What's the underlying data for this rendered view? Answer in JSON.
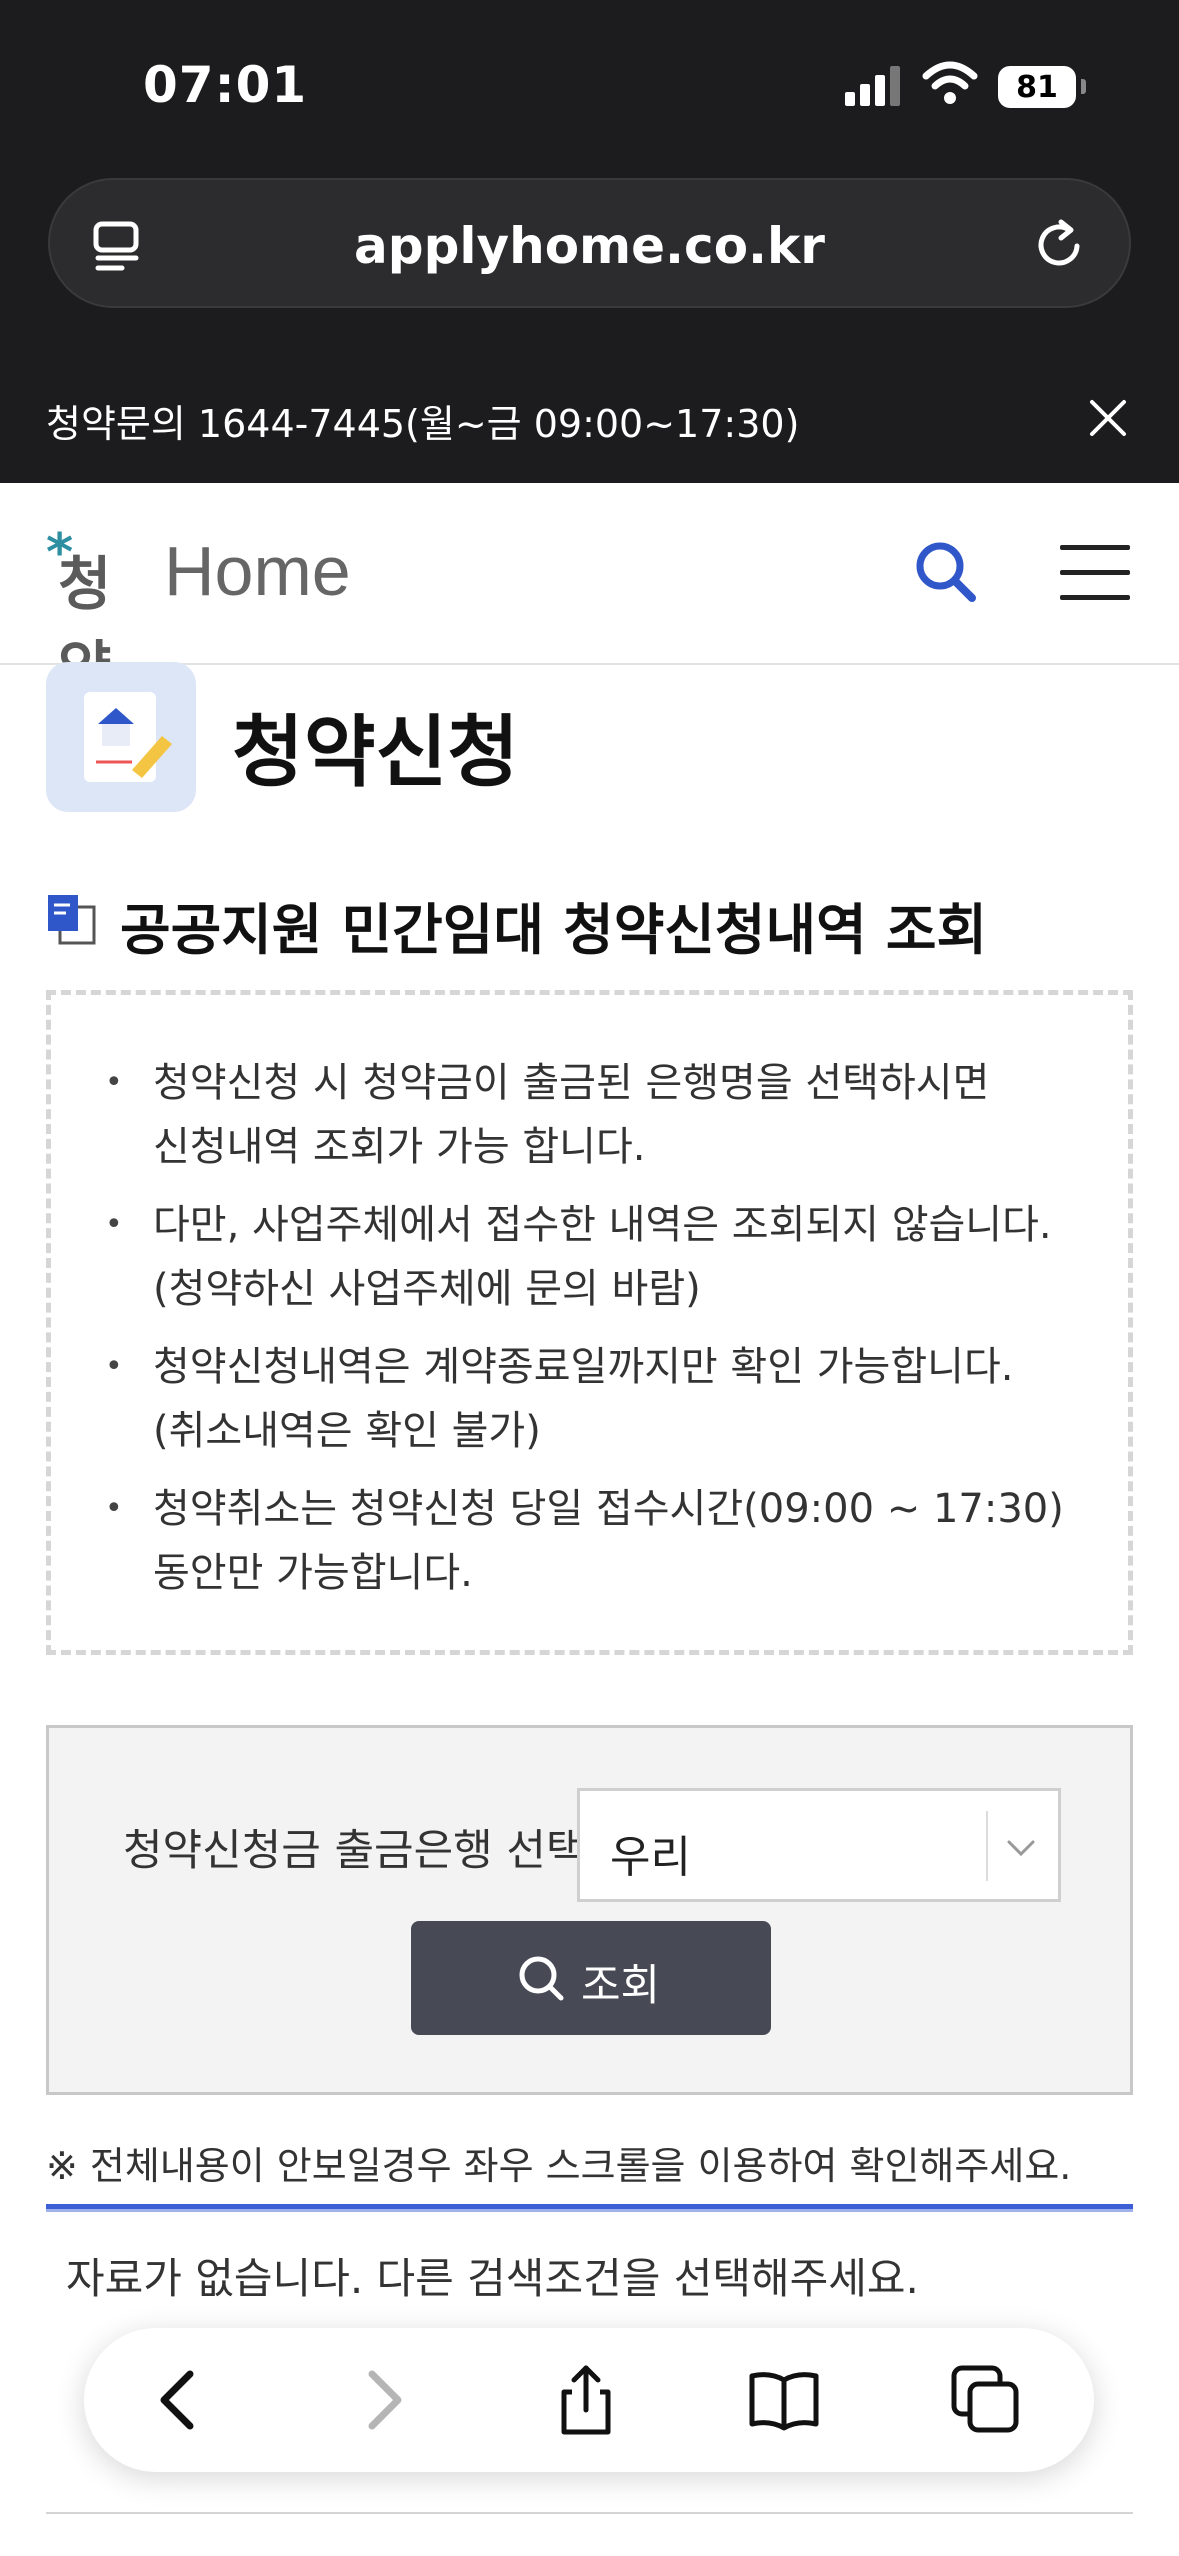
{
  "status_bar": {
    "time": "07:01",
    "battery": "81"
  },
  "browser": {
    "url": "applyhome.co.kr"
  },
  "notice_banner": {
    "text": "청약문의 1644-7445(월~금 09:00~17:30)"
  },
  "header": {
    "logo_star": "*",
    "logo_ko": "청약",
    "logo_en": "Home"
  },
  "page": {
    "title": "청약신청"
  },
  "section": {
    "title": "공공지원 민간임대 청약신청내역 조회"
  },
  "info_items": [
    {
      "line1": "청약신청 시 청약금이 출금된 은행명을 선택하시면",
      "line2": "신청내역 조회가 가능 합니다."
    },
    {
      "line1": "다만, 사업주체에서 접수한 내역은 조회되지 않습니다.",
      "line2": "(청약하신 사업주체에 문의 바람)"
    },
    {
      "line1": "청약신청내역은 계약종료일까지만 확인 가능합니다.",
      "line2": "(취소내역은 확인 불가)"
    },
    {
      "line1": "청약취소는 청약신청 당일 접수시간(09:00 ~ 17:30)",
      "line2": "동안만 가능합니다."
    }
  ],
  "search_form": {
    "bank_label": "청약신청금 출금은행 선택",
    "bank_selected": "우리",
    "query_button": "조회"
  },
  "scroll_note": "※ 전체내용이 안보일경우 좌우 스크롤을 이용하여 확인해주세요.",
  "result": {
    "empty_message": "자료가 없습니다. 다른 검색조건을 선택해주세요."
  },
  "colors": {
    "accent_blue": "#3c5fd6",
    "logo_teal": "#2d8fa1",
    "chrome_bg": "#1c1c1e",
    "button_dark": "#474a55"
  }
}
